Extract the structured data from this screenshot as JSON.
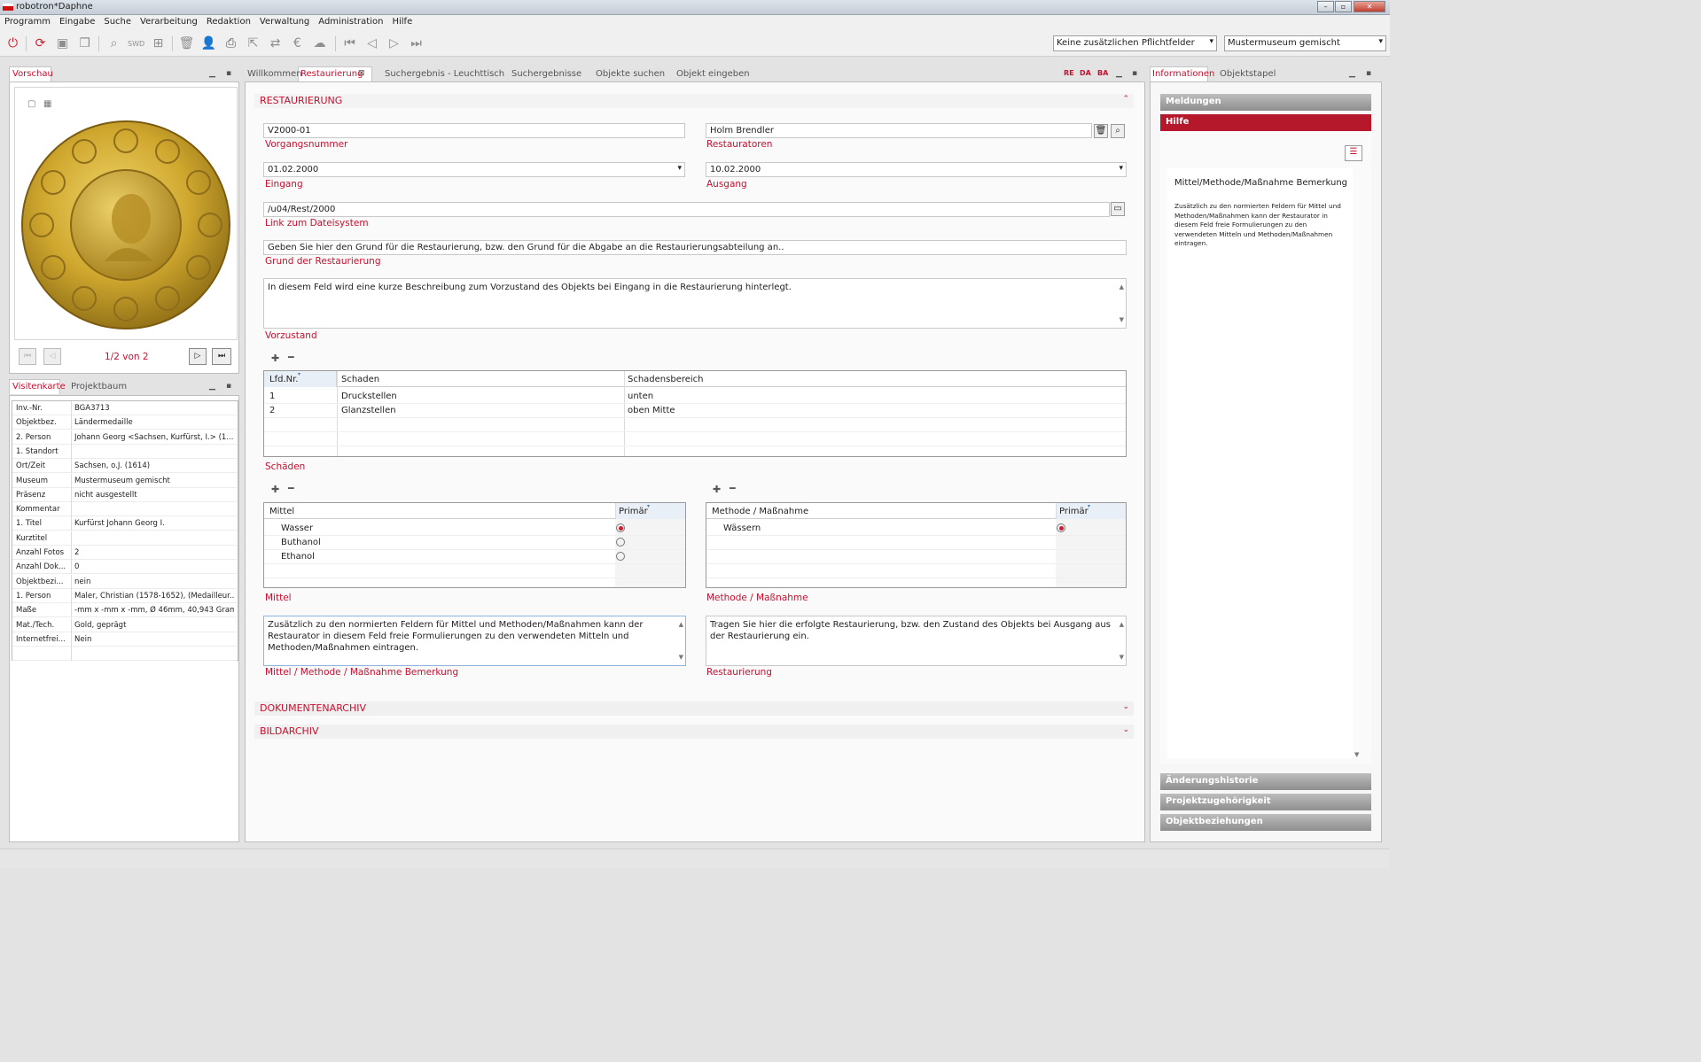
{
  "window": {
    "title": "robotron*Daphne"
  },
  "menu": [
    "Programm",
    "Eingabe",
    "Suche",
    "Verarbeitung",
    "Redaktion",
    "Verwaltung",
    "Administration",
    "Hilfe"
  ],
  "toolbar": {
    "pflicht_select": "Keine zusätzlichen Pflichtfelder",
    "museum_select": "Mustermuseum gemischt"
  },
  "preview": {
    "tab": "Vorschau",
    "counter": "1/2 von 2",
    "image_desc": "gold-coin"
  },
  "visitenkarte": {
    "tabs": [
      "Visitenkarte",
      "Projektbaum"
    ],
    "rows": [
      {
        "k": "Inv.-Nr.",
        "v": "BGA3713"
      },
      {
        "k": "Objektbez.",
        "v": "Ländermedaille"
      },
      {
        "k": "2. Person",
        "v": "Johann Georg <Sachsen, Kurfürst, I.> (1..."
      },
      {
        "k": "1. Standort",
        "v": ""
      },
      {
        "k": "Ort/Zeit",
        "v": "Sachsen, o.J. (1614)"
      },
      {
        "k": "Museum",
        "v": "Mustermuseum gemischt"
      },
      {
        "k": "Präsenz",
        "v": "nicht ausgestellt"
      },
      {
        "k": "Kommentar",
        "v": ""
      },
      {
        "k": "1. Titel",
        "v": "Kurfürst Johann Georg I."
      },
      {
        "k": "Kurztitel",
        "v": ""
      },
      {
        "k": "Anzahl Fotos",
        "v": "2"
      },
      {
        "k": "Anzahl Dok...",
        "v": "0"
      },
      {
        "k": "Objektbezi...",
        "v": "nein"
      },
      {
        "k": "1. Person",
        "v": "Maler, Christian (1578-1652), (Medailleur..."
      },
      {
        "k": "Maße",
        "v": "-mm x -mm x -mm, Ø 46mm, 40,943 Gramm"
      },
      {
        "k": "Mat./Tech.",
        "v": "Gold, geprägt"
      },
      {
        "k": "Internetfrei...",
        "v": "Nein"
      }
    ]
  },
  "main_tabs": [
    "Willkommen",
    "Restaurierung",
    "Suchergebnis - Leuchttisch",
    "Suchergebnisse",
    "Objekte suchen",
    "Objekt eingeben"
  ],
  "lang_codes": [
    "RE",
    "DA",
    "BA"
  ],
  "form": {
    "section_title": "RESTAURIERUNG",
    "vorgangsnummer": {
      "value": "V2000-01",
      "label": "Vorgangsnummer"
    },
    "restauratoren": {
      "value": "Holm Brendler",
      "label": "Restauratoren"
    },
    "eingang": {
      "value": "01.02.2000",
      "label": "Eingang"
    },
    "ausgang": {
      "value": "10.02.2000",
      "label": "Ausgang"
    },
    "link": {
      "value": "/u04/Rest/2000",
      "label": "Link zum Dateisystem"
    },
    "grund": {
      "value": "Geben Sie hier den Grund für die Restaurierung, bzw. den Grund für die Abgabe an die Restaurierungsabteilung an..",
      "label": "Grund der Restaurierung"
    },
    "vorzustand": {
      "value": "In diesem Feld wird eine kurze Beschreibung zum Vorzustand des Objekts bei Eingang in die Restaurierung hinterlegt.",
      "label": "Vorzustand"
    },
    "schaeden": {
      "label": "Schäden",
      "headers": [
        "Lfd.Nr.",
        "Schaden",
        "Schadensbereich"
      ],
      "rows": [
        [
          "1",
          "Druckstellen",
          "unten"
        ],
        [
          "2",
          "Glanzstellen",
          "oben Mitte"
        ]
      ]
    },
    "mittel": {
      "label": "Mittel",
      "headers": [
        "Mittel",
        "Primär"
      ],
      "rows": [
        {
          "name": "Wasser",
          "primary": true
        },
        {
          "name": "Buthanol",
          "primary": false
        },
        {
          "name": "Ethanol",
          "primary": false
        }
      ]
    },
    "methode": {
      "label": "Methode / Maßnahme",
      "headers": [
        "Methode / Maßnahme",
        "Primär"
      ],
      "rows": [
        {
          "name": "Wässern",
          "primary": true
        }
      ]
    },
    "bemerkung": {
      "value": "Zusätzlich zu den normierten Feldern für Mittel und Methoden/Maßnahmen kann der Restaurator in diesem Feld freie Formulierungen zu den verwendeten Mitteln und Methoden/Maßnahmen eintragen.",
      "label": "Mittel / Methode / Maßnahme Bemerkung"
    },
    "restaurierung": {
      "value": "Tragen Sie hier die erfolgte Restaurierung, bzw. den Zustand des Objekts bei Ausgang aus der Restaurierung ein.",
      "label": "Restaurierung"
    }
  },
  "sections": [
    "DOKUMENTENARCHIV",
    "BILDARCHIV"
  ],
  "info": {
    "tabs": [
      "Informationen",
      "Objektstapel"
    ],
    "bars_top": [
      "Meldungen",
      "Hilfe"
    ],
    "help_title": "Mittel/Methode/Maßnahme Bemerkung",
    "help_text": "Zusätzlich zu den normierten Feldern für Mittel und Methoden/Maßnahmen kann der Restaurator in diesem Feld freie Formulierungen zu den verwendeten Mitteln und Methoden/Maßnahmen eintragen.",
    "bars_bottom": [
      "Änderungshistorie",
      "Projektzugehörigkeit",
      "Objektbeziehungen"
    ]
  },
  "colors": {
    "accent": "#c8102e",
    "background": "#e3e3e3"
  }
}
